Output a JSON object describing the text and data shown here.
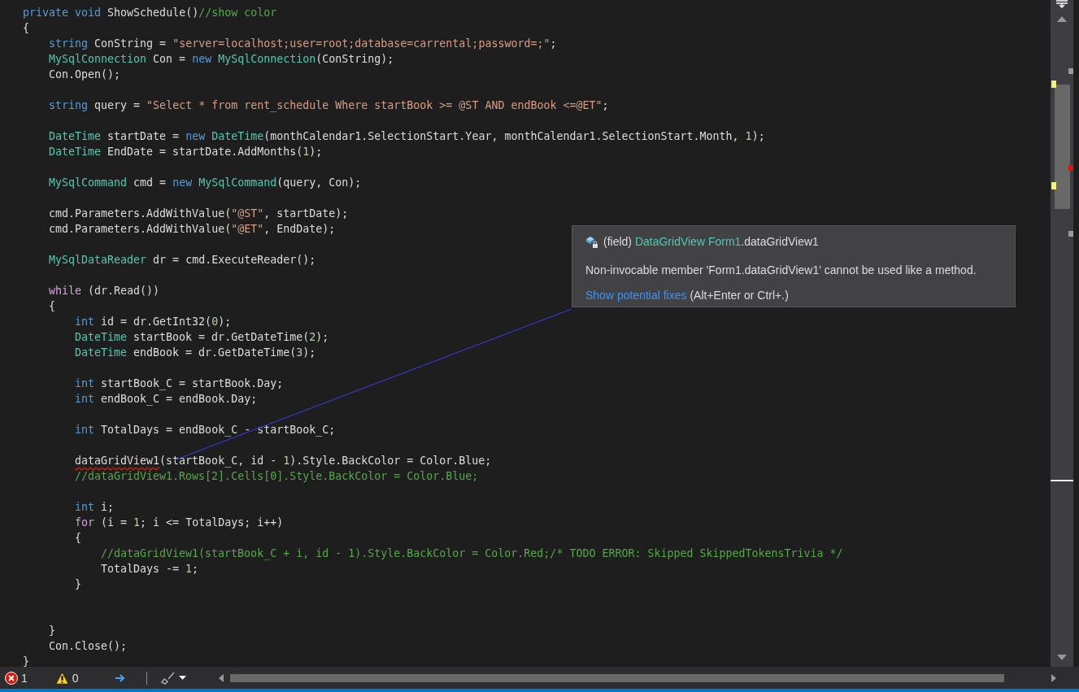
{
  "code_lines": [
    {
      "kind": "code",
      "tokens": [
        {
          "kind": "kw",
          "text": "private void "
        },
        {
          "kind": "plain",
          "text": "ShowSchedule()"
        },
        {
          "kind": "com",
          "text": "//show color"
        }
      ]
    },
    {
      "kind": "code",
      "tokens": [
        {
          "kind": "plain",
          "text": "{"
        }
      ],
      "children": [
        {
          "kind": "code",
          "tokens": [
            {
              "kind": "kw",
              "text": "string"
            },
            {
              "kind": "plain",
              "text": " ConString = "
            },
            {
              "kind": "str",
              "text": "\"server=localhost;user=root;database=carrental;password=;\""
            },
            {
              "kind": "plain",
              "text": ";"
            }
          ]
        },
        {
          "kind": "code",
          "tokens": [
            {
              "kind": "type",
              "text": "MySqlConnection"
            },
            {
              "kind": "plain",
              "text": " Con = "
            },
            {
              "kind": "kw",
              "text": "new "
            },
            {
              "kind": "type",
              "text": "MySqlConnection"
            },
            {
              "kind": "plain",
              "text": "(ConString);"
            }
          ]
        },
        {
          "kind": "code",
          "tokens": [
            {
              "kind": "plain",
              "text": "Con.Open();"
            }
          ]
        },
        {
          "kind": "blank"
        },
        {
          "kind": "code",
          "tokens": [
            {
              "kind": "kw",
              "text": "string"
            },
            {
              "kind": "plain",
              "text": " query = "
            },
            {
              "kind": "str",
              "text": "\"Select * from rent_schedule Where startBook >= @ST AND endBook <=@ET\""
            },
            {
              "kind": "plain",
              "text": ";"
            }
          ]
        },
        {
          "kind": "blank"
        },
        {
          "kind": "code",
          "tokens": [
            {
              "kind": "type",
              "text": "DateTime"
            },
            {
              "kind": "plain",
              "text": " startDate = "
            },
            {
              "kind": "kw",
              "text": "new "
            },
            {
              "kind": "type",
              "text": "DateTime"
            },
            {
              "kind": "plain",
              "text": "(monthCalendar1.SelectionStart.Year, monthCalendar1.SelectionStart.Month, "
            },
            {
              "kind": "num",
              "text": "1"
            },
            {
              "kind": "plain",
              "text": ");"
            }
          ]
        },
        {
          "kind": "code",
          "tokens": [
            {
              "kind": "type",
              "text": "DateTime"
            },
            {
              "kind": "plain",
              "text": " EndDate = startDate.AddMonths("
            },
            {
              "kind": "num",
              "text": "1"
            },
            {
              "kind": "plain",
              "text": ");"
            }
          ]
        },
        {
          "kind": "blank"
        },
        {
          "kind": "code",
          "tokens": [
            {
              "kind": "type",
              "text": "MySqlCommand"
            },
            {
              "kind": "plain",
              "text": " cmd = "
            },
            {
              "kind": "kw",
              "text": "new "
            },
            {
              "kind": "type",
              "text": "MySqlCommand"
            },
            {
              "kind": "plain",
              "text": "(query, Con);"
            }
          ]
        },
        {
          "kind": "blank"
        },
        {
          "kind": "code",
          "tokens": [
            {
              "kind": "plain",
              "text": "cmd.Parameters.AddWithValue("
            },
            {
              "kind": "str",
              "text": "\"@ST\""
            },
            {
              "kind": "plain",
              "text": ", startDate);"
            }
          ]
        },
        {
          "kind": "code",
          "tokens": [
            {
              "kind": "plain",
              "text": "cmd.Parameters.AddWithValue("
            },
            {
              "kind": "str",
              "text": "\"@ET\""
            },
            {
              "kind": "plain",
              "text": ", EndDate);"
            }
          ]
        },
        {
          "kind": "blank"
        },
        {
          "kind": "code",
          "tokens": [
            {
              "kind": "type",
              "text": "MySqlDataReader"
            },
            {
              "kind": "plain",
              "text": " dr = cmd.ExecuteReader();"
            }
          ]
        },
        {
          "kind": "blank"
        },
        {
          "kind": "code",
          "tokens": [
            {
              "kind": "ctl",
              "text": "while"
            },
            {
              "kind": "plain",
              "text": " (dr.Read())"
            }
          ]
        },
        {
          "kind": "code",
          "tokens": [
            {
              "kind": "plain",
              "text": "{"
            }
          ],
          "children": [
            {
              "kind": "code",
              "tokens": [
                {
                  "kind": "kw",
                  "text": "int"
                },
                {
                  "kind": "plain",
                  "text": " id = dr.GetInt32("
                },
                {
                  "kind": "num",
                  "text": "0"
                },
                {
                  "kind": "plain",
                  "text": ");"
                }
              ]
            },
            {
              "kind": "code",
              "tokens": [
                {
                  "kind": "type",
                  "text": "DateTime"
                },
                {
                  "kind": "plain",
                  "text": " startBook = dr.GetDateTime("
                },
                {
                  "kind": "num",
                  "text": "2"
                },
                {
                  "kind": "plain",
                  "text": ");"
                }
              ]
            },
            {
              "kind": "code",
              "tokens": [
                {
                  "kind": "type",
                  "text": "DateTime"
                },
                {
                  "kind": "plain",
                  "text": " endBook = dr.GetDateTime("
                },
                {
                  "kind": "num",
                  "text": "3"
                },
                {
                  "kind": "plain",
                  "text": ");"
                }
              ]
            },
            {
              "kind": "blank"
            },
            {
              "kind": "code",
              "tokens": [
                {
                  "kind": "kw",
                  "text": "int"
                },
                {
                  "kind": "plain",
                  "text": " startBook_C = startBook.Day;"
                }
              ]
            },
            {
              "kind": "code",
              "tokens": [
                {
                  "kind": "kw",
                  "text": "int"
                },
                {
                  "kind": "plain",
                  "text": " endBook_C = endBook.Day;"
                }
              ]
            },
            {
              "kind": "blank"
            },
            {
              "kind": "code",
              "tokens": [
                {
                  "kind": "kw",
                  "text": "int"
                },
                {
                  "kind": "plain",
                  "text": " TotalDays = endBook_C - startBook_C;"
                }
              ]
            },
            {
              "kind": "blank"
            },
            {
              "kind": "code",
              "tokens": [
                {
                  "kind": "err",
                  "text": "dataGridView1"
                },
                {
                  "kind": "plain",
                  "text": "(startBook_C, id - "
                },
                {
                  "kind": "num",
                  "text": "1"
                },
                {
                  "kind": "plain",
                  "text": ").Style.BackColor = Color.Blue;"
                }
              ]
            },
            {
              "kind": "code",
              "tokens": [
                {
                  "kind": "com",
                  "text": "//dataGridView1.Rows[2].Cells[0].Style.BackColor = Color.Blue;"
                }
              ]
            },
            {
              "kind": "blank"
            },
            {
              "kind": "code",
              "tokens": [
                {
                  "kind": "kw",
                  "text": "int"
                },
                {
                  "kind": "plain",
                  "text": " i;"
                }
              ]
            },
            {
              "kind": "code",
              "tokens": [
                {
                  "kind": "ctl",
                  "text": "for"
                },
                {
                  "kind": "plain",
                  "text": " (i = "
                },
                {
                  "kind": "num",
                  "text": "1"
                },
                {
                  "kind": "plain",
                  "text": "; i <= TotalDays; i++)"
                }
              ]
            },
            {
              "kind": "code",
              "tokens": [
                {
                  "kind": "plain",
                  "text": "{"
                }
              ],
              "children": [
                {
                  "kind": "code",
                  "tokens": [
                    {
                      "kind": "com",
                      "text": "//dataGridView1(startBook_C + i, id - 1).Style.BackColor = Color.Red;/* TODO ERROR: Skipped SkippedTokensTrivia */"
                    }
                  ]
                },
                {
                  "kind": "code",
                  "tokens": [
                    {
                      "kind": "plain",
                      "text": "TotalDays -= "
                    },
                    {
                      "kind": "num",
                      "text": "1"
                    },
                    {
                      "kind": "plain",
                      "text": ";"
                    }
                  ]
                }
              ]
            },
            {
              "kind": "code",
              "tokens": [
                {
                  "kind": "plain",
                  "text": "}"
                }
              ]
            },
            {
              "kind": "blank"
            },
            {
              "kind": "blank"
            }
          ]
        },
        {
          "kind": "code",
          "tokens": [
            {
              "kind": "plain",
              "text": "}"
            }
          ]
        },
        {
          "kind": "code",
          "tokens": [
            {
              "kind": "plain",
              "text": "Con.Close();"
            }
          ]
        }
      ]
    },
    {
      "kind": "code",
      "tokens": [
        {
          "kind": "plain",
          "text": "}"
        }
      ]
    }
  ],
  "tooltip": {
    "prefix": "(field)",
    "type_name": "DataGridView",
    "class_name": "Form1",
    "member": ".dataGridView1",
    "message": "Non-invocable member 'Form1.dataGridView1' cannot be used like a method.",
    "link": "Show potential fixes",
    "shortcut": "(Alt+Enter or Ctrl+.)"
  },
  "status_bar": {
    "errors": "1",
    "warnings": "0"
  }
}
